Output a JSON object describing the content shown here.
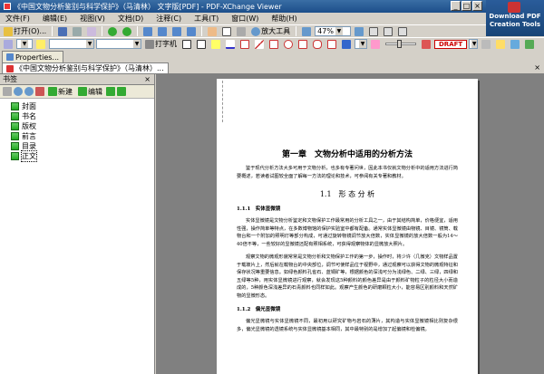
{
  "window": {
    "title": "《中国文物分析鉴别与科学保护》（马清林） 文字版[PDF] - PDF-XChange Viewer",
    "minimize": "_",
    "maximize": "□",
    "close": "×"
  },
  "brand": {
    "line1": "Download PDF",
    "line2": "Creation Tools"
  },
  "menu": [
    "文件(F)",
    "编辑(E)",
    "视图(V)",
    "文档(D)",
    "注释(C)",
    "工具(T)",
    "窗口(W)",
    "帮助(H)"
  ],
  "toolbar1": {
    "open_label": "打开(O)...",
    "zoom_tool_label": "放大工具",
    "zoom_value": "47%"
  },
  "toolbar2": {
    "typewriter_label": "打字机",
    "stamp_label": "DRAFT"
  },
  "panel_tabs": [
    {
      "label": "Properties..."
    }
  ],
  "doc_tab": {
    "label": "《中国文物分析鉴别与科学保护》（马清林）...",
    "close": "×"
  },
  "bookmarks_panel": {
    "title": "书签",
    "close": "×",
    "new_label": "新建",
    "edit_label": "编辑",
    "items": [
      {
        "label": "封面"
      },
      {
        "label": "书名"
      },
      {
        "label": "版权"
      },
      {
        "label": "前言"
      },
      {
        "label": "目录"
      },
      {
        "label": "正文"
      }
    ]
  },
  "page": {
    "chapter_title": "第一章　文物分析中适用的分析方法",
    "intro": "鉴于现代分析方法大多可用于文物分析，也多有专著问世，因此本书仅就文物分析中的适用方法进行简要概述，若读者试图较全面了解每一方法的理论和技术，可参阅有关专著和教材。",
    "section_title": "1.1　形 态 分 析",
    "sub1_title": "1.1.1　实体显微镜",
    "sub1_p1": "实体显微镜是文物分析鉴定和文物保护工作最常用的分析工具之一，由于其结构简单，价格便宜，适用性强，操作简单等特点，在多数博物馆的保护实验室中都有配备。通常实体显微镜由物镜、目镜、镜筒、载物台和一个附加的照明灯等部分构成，可通过旋转物镜调节放大倍数，实体显微镜的放大倍数一般为14～40倍不等，一些较好的显微镜还配有照相系统，可获得观察物体的显微放大照片。",
    "sub1_p2": "观察文物的微观形貌常常是文物分析和文物保护工作的第一步，操作时，将少许（几微克）文物样品置于载玻片上，然后就在载物台的中央部位，调节可使样品位于视野中，通过观察可以获得文物的微观特征和保存状况等重要信息。如绿色颜料孔雀石、蓝铜矿等，根据颜色的深浅可分为浅绿色、二绿、三绿，四绿和五绿等5种，用实体显微镜进行观察，就会发现这5种颜料的颜色差异是由于颜料矿物粒子的粒径大小而造成的，5种颜色深浅差异的石青颜料也同样如此。观察产生颜色的研磨颗粒大小，能容易区别颜料和天然矿物的显微形态。",
    "sub2_title": "1.1.2　偏光显微镜",
    "sub2_p1": "偏光显微镜与实体显微镜不同，最初用以研究矿物与岩石的薄片，其构造与实体显微镜相比则复杂很多，偏光显微镜的透镜系统与实体显微镜基本相同，其中最特别的是增加了起偏镜和检偏镜。"
  }
}
